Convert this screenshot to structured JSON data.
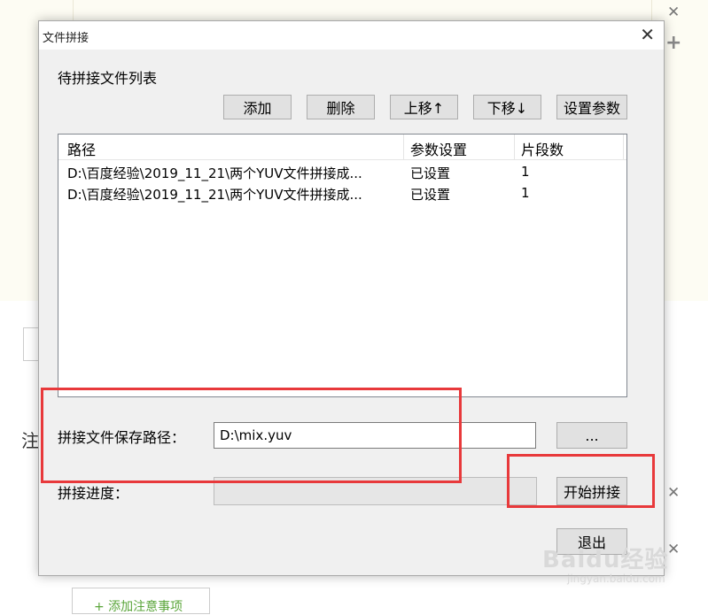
{
  "background": {
    "add_note_label": "+ 添加注意事项",
    "side_char": "注"
  },
  "dialog": {
    "title": "文件拼接",
    "close_glyph": "✕",
    "list_section_label": "待拼接文件列表",
    "toolbar": {
      "add": "添加",
      "delete": "删除",
      "move_up": "上移↑",
      "move_down": "下移↓",
      "set_params": "设置参数"
    },
    "table": {
      "columns": [
        "路径",
        "参数设置",
        "片段数"
      ],
      "rows": [
        {
          "path": "D:\\百度经验\\2019_11_21\\两个YUV文件拼接成...",
          "params": "已设置",
          "segments": "1"
        },
        {
          "path": "D:\\百度经验\\2019_11_21\\两个YUV文件拼接成...",
          "params": "已设置",
          "segments": "1"
        }
      ]
    },
    "save_path_label": "拼接文件保存路径：",
    "save_path_value": "D:\\mix.yuv",
    "browse_label": "...",
    "progress_label": "拼接进度：",
    "progress_value": 0,
    "start_label": "开始拼接",
    "exit_label": "退出"
  },
  "watermark": {
    "text": "Baidu经验",
    "sub": "jingyan.baidu.com"
  },
  "colors": {
    "highlight_box": "#e8393b",
    "dialog_bg": "#f0f0f0"
  }
}
